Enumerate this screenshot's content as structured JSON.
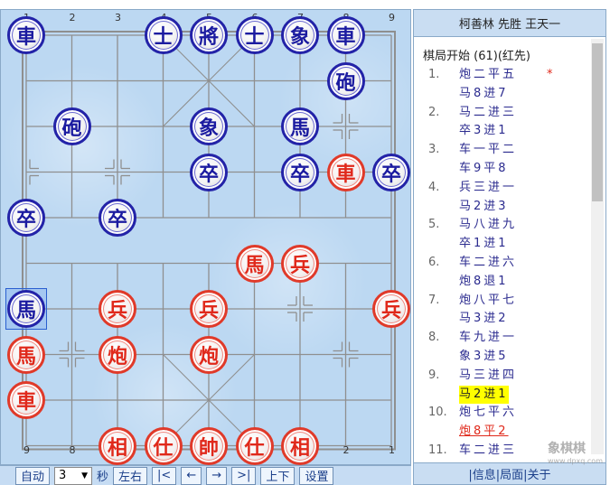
{
  "board": {
    "top_numbers": [
      "1",
      "2",
      "3",
      "4",
      "5",
      "6",
      "7",
      "8",
      "9"
    ],
    "bottom_numbers": [
      "9",
      "8",
      "7",
      "6",
      "5",
      "4",
      "3",
      "2",
      "1"
    ],
    "selected": {
      "file": 0,
      "rank": 6
    },
    "pieces": [
      {
        "side": "black",
        "char": "車",
        "file": 0,
        "rank": 0
      },
      {
        "side": "black",
        "char": "士",
        "file": 3,
        "rank": 0
      },
      {
        "side": "black",
        "char": "將",
        "file": 4,
        "rank": 0
      },
      {
        "side": "black",
        "char": "士",
        "file": 5,
        "rank": 0
      },
      {
        "side": "black",
        "char": "象",
        "file": 6,
        "rank": 0
      },
      {
        "side": "black",
        "char": "車",
        "file": 7,
        "rank": 0
      },
      {
        "side": "black",
        "char": "砲",
        "file": 7,
        "rank": 1
      },
      {
        "side": "black",
        "char": "砲",
        "file": 1,
        "rank": 2
      },
      {
        "side": "black",
        "char": "象",
        "file": 4,
        "rank": 2
      },
      {
        "side": "black",
        "char": "馬",
        "file": 6,
        "rank": 2
      },
      {
        "side": "black",
        "char": "卒",
        "file": 4,
        "rank": 3
      },
      {
        "side": "black",
        "char": "卒",
        "file": 6,
        "rank": 3
      },
      {
        "side": "red",
        "char": "車",
        "file": 7,
        "rank": 3
      },
      {
        "side": "black",
        "char": "卒",
        "file": 8,
        "rank": 3
      },
      {
        "side": "black",
        "char": "卒",
        "file": 0,
        "rank": 4
      },
      {
        "side": "black",
        "char": "卒",
        "file": 2,
        "rank": 4
      },
      {
        "side": "red",
        "char": "馬",
        "file": 5,
        "rank": 5
      },
      {
        "side": "red",
        "char": "兵",
        "file": 6,
        "rank": 5
      },
      {
        "side": "black",
        "char": "馬",
        "file": 0,
        "rank": 6
      },
      {
        "side": "red",
        "char": "兵",
        "file": 2,
        "rank": 6
      },
      {
        "side": "red",
        "char": "兵",
        "file": 4,
        "rank": 6
      },
      {
        "side": "red",
        "char": "兵",
        "file": 8,
        "rank": 6
      },
      {
        "side": "red",
        "char": "馬",
        "file": 0,
        "rank": 7
      },
      {
        "side": "red",
        "char": "炮",
        "file": 2,
        "rank": 7
      },
      {
        "side": "red",
        "char": "炮",
        "file": 4,
        "rank": 7
      },
      {
        "side": "red",
        "char": "車",
        "file": 0,
        "rank": 8
      },
      {
        "side": "red",
        "char": "相",
        "file": 2,
        "rank": 9
      },
      {
        "side": "red",
        "char": "仕",
        "file": 3,
        "rank": 9
      },
      {
        "side": "red",
        "char": "帥",
        "file": 4,
        "rank": 9
      },
      {
        "side": "red",
        "char": "仕",
        "file": 5,
        "rank": 9
      },
      {
        "side": "red",
        "char": "相",
        "file": 6,
        "rank": 9
      }
    ]
  },
  "controls": {
    "auto": "自动",
    "seconds_value": "3",
    "seconds_unit": "秒",
    "flip_lr": "左右",
    "first": "|<",
    "prev": "←",
    "next": "→",
    "last": ">|",
    "flip_ud": "上下",
    "settings": "设置"
  },
  "panel": {
    "title": "柯善林 先胜 王天一",
    "header": "棋局开始 (61)(红先)",
    "moves": [
      {
        "num": "1.",
        "red": "炮二平五",
        "black": "马8进7",
        "mark": "*"
      },
      {
        "num": "2.",
        "red": "马二进三",
        "black": "卒3进1"
      },
      {
        "num": "3.",
        "red": "车一平二",
        "black": "车9平8"
      },
      {
        "num": "4.",
        "red": "兵三进一",
        "black": "马2进3"
      },
      {
        "num": "5.",
        "red": "马八进九",
        "black": "卒1进1"
      },
      {
        "num": "6.",
        "red": "车二进六",
        "black": "炮8退1"
      },
      {
        "num": "7.",
        "red": "炮八平七",
        "black": "马3进2"
      },
      {
        "num": "8.",
        "red": "车九进一",
        "black": "象3进5"
      },
      {
        "num": "9.",
        "red": "马三进四",
        "black": "马2进1"
      },
      {
        "num": "10.",
        "red": "炮七平六",
        "black": "炮8平2"
      },
      {
        "num": "11.",
        "red": "车二进三",
        "black": ""
      }
    ],
    "highlighted_move": "马2进1",
    "current_move": "炮8平2",
    "footer": "|信息|局面|关于"
  },
  "watermark": {
    "text": "象棋棋",
    "sub": "www.dpxq.com"
  }
}
